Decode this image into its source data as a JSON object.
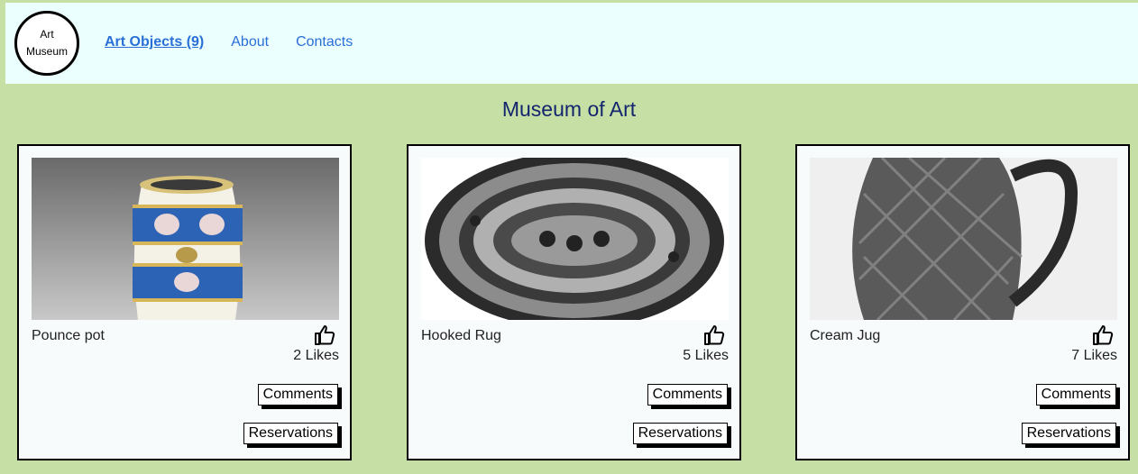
{
  "logo": {
    "line1": "Art",
    "line2": "Museum"
  },
  "nav": {
    "items": [
      "Art Objects (9)",
      "About",
      "Contacts"
    ]
  },
  "page_title": "Museum of Art",
  "cards": [
    {
      "name": "Pounce pot",
      "likes": "2 Likes",
      "comments_label": "Comments",
      "reservations_label": "Reservations"
    },
    {
      "name": "Hooked Rug",
      "likes": "5 Likes",
      "comments_label": "Comments",
      "reservations_label": "Reservations"
    },
    {
      "name": "Cream Jug",
      "likes": "7 Likes",
      "comments_label": "Comments",
      "reservations_label": "Reservations"
    }
  ],
  "colors": {
    "background": "#c5dfa5",
    "header": "#ebffff",
    "link": "#2a6fd6",
    "title": "#14256e"
  }
}
